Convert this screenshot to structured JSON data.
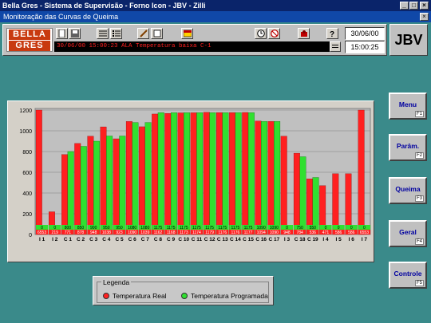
{
  "window": {
    "title": "Bella Gres - Sistema de Supervisão - Forno Icon - JBV - Zilli",
    "subtitle": "Monitoração das Curvas de Queima"
  },
  "logo": {
    "line1": "BELLA",
    "line2": "GRES"
  },
  "toolbar": {
    "icons": [
      "file-icon",
      "save-icon",
      "list-icon",
      "list-alt-icon",
      "tools-icon",
      "edit-icon",
      "document-icon",
      "clock-icon",
      "stop-icon",
      "alert-icon",
      "help-icon"
    ]
  },
  "alarm_text": "30/06/00 15:00:23 ALA Temperatura baixa C-1",
  "date": "30/06/00",
  "time": "15:00:25",
  "station": "JBV",
  "nav": [
    {
      "label": "Menu",
      "key": "F1"
    },
    {
      "label": "Parâm.",
      "key": "F2"
    },
    {
      "label": "Queima",
      "key": "F3"
    },
    {
      "label": "Geral",
      "key": "F4"
    },
    {
      "label": "Controle",
      "key": "F5"
    }
  ],
  "legend": {
    "title": "Legenda",
    "real": "Temperatura Real",
    "programada": "Temperatura Programada",
    "color_real": "#ff2020",
    "color_prog": "#30e030"
  },
  "chart_data": {
    "type": "bar",
    "ylim": [
      0,
      1200
    ],
    "yticks": [
      0,
      200,
      400,
      600,
      800,
      1000,
      1200
    ],
    "categories": [
      "I 1",
      "I 2",
      "C 1",
      "C 2",
      "C 3",
      "C 4",
      "C 5",
      "C 6",
      "C 7",
      "C 8",
      "C 9",
      "C 10",
      "C 11",
      "C 12",
      "C 13",
      "C 14",
      "C 15",
      "C 16",
      "C 17",
      "I 3",
      "C 18",
      "C 19",
      "I 4",
      "I 5",
      "I 6",
      "I 7"
    ],
    "series": [
      {
        "name": "Temperatura Real",
        "values": [
          6553,
          219,
          771,
          878,
          948,
          1038,
          923,
          1090,
          1039,
          1162,
          1168,
          1173,
          1174,
          1179,
          1176,
          1176,
          1177,
          1094,
          1090,
          948,
          784,
          536,
          471,
          586,
          586,
          6553
        ]
      },
      {
        "name": "Temperatura Programada",
        "values": [
          0,
          0,
          800,
          850,
          900,
          950,
          950,
          1080,
          1080,
          1175,
          1175,
          1175,
          1175,
          1175,
          1175,
          1175,
          1175,
          1090,
          1090,
          0,
          750,
          550,
          0,
          0,
          0,
          0
        ]
      }
    ]
  }
}
